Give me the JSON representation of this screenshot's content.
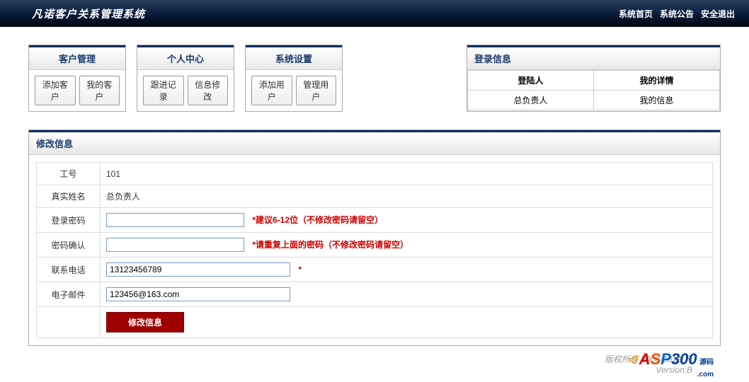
{
  "header": {
    "title": "凡诺客户关系管理系统",
    "links": [
      "系统首页",
      "系统公告",
      "安全退出"
    ]
  },
  "tabs": [
    {
      "title": "客户管理",
      "buttons": [
        "添加客户",
        "我的客户"
      ]
    },
    {
      "title": "个人中心",
      "buttons": [
        "跟进记录",
        "信息修改"
      ]
    },
    {
      "title": "系统设置",
      "buttons": [
        "添加用户",
        "管理用户"
      ]
    }
  ],
  "login_info": {
    "title": "登录信息",
    "headers": [
      "登陆人",
      "我的详情"
    ],
    "row": [
      "总负责人",
      "我的信息"
    ]
  },
  "panel": {
    "title": "修改信息",
    "rows": [
      {
        "label": "工号",
        "type": "text",
        "value": "101"
      },
      {
        "label": "真实姓名",
        "type": "text",
        "value": "总负责人"
      },
      {
        "label": "登录密码",
        "type": "input",
        "value": "",
        "width": "w200",
        "hint": "*建议6-12位（不修改密码请留空）"
      },
      {
        "label": "密码确认",
        "type": "input",
        "value": "",
        "width": "w200",
        "hint": "*请重复上面的密码（不修改密码请留空）"
      },
      {
        "label": "联系电话",
        "type": "input",
        "value": "13123456789",
        "width": "w260",
        "hint": "*"
      },
      {
        "label": "电子邮件",
        "type": "input",
        "value": "123456@163.com",
        "width": "w260",
        "hint": ""
      }
    ],
    "submit": "修改信息"
  },
  "footer": {
    "copyright": "版权所有 2008-2012 凡",
    "version": "Version:B"
  }
}
